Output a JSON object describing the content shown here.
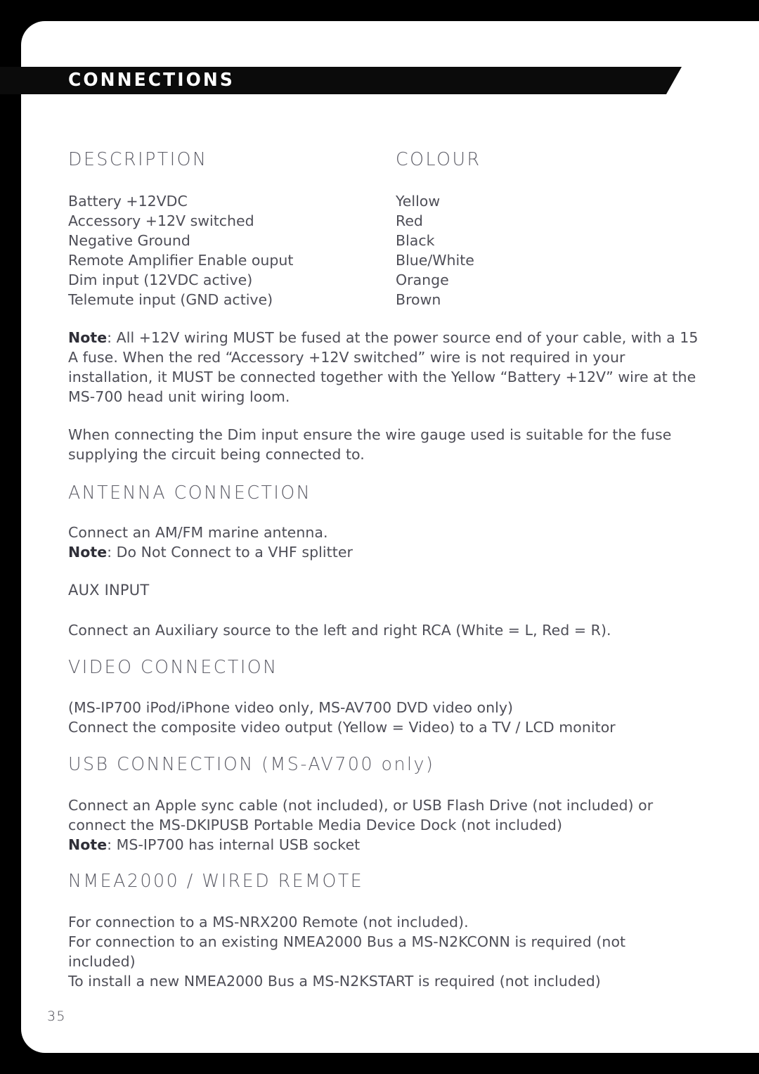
{
  "banner": {
    "title": "CONNECTIONS"
  },
  "table": {
    "headers": {
      "description": "DESCRIPTION",
      "colour": "COLOUR"
    },
    "rows": [
      {
        "description": "Battery +12VDC",
        "colour": "Yellow"
      },
      {
        "description": "Accessory +12V switched",
        "colour": "Red"
      },
      {
        "description": "Negative Ground",
        "colour": "Black"
      },
      {
        "description": "Remote Amplifier Enable ouput",
        "colour": "Blue/White"
      },
      {
        "description": "Dim input (12VDC active)",
        "colour": "Orange"
      },
      {
        "description": "Telemute input (GND active)",
        "colour": "Brown"
      }
    ]
  },
  "notes": {
    "note_label": "Note",
    "power_note": ": All +12V wiring MUST be fused at the power source end of your cable, with a 15 A fuse. When the red “Accessory +12V switched” wire is not required in your installation, it MUST be connected together with the Yellow “Battery +12V” wire at the MS-700 head unit wiring loom.",
    "dim_note": "When connecting the Dim input ensure the wire gauge used is suitable for the fuse supplying the circuit being connected to."
  },
  "sections": {
    "antenna": {
      "heading": "ANTENNA CONNECTION",
      "line1": "Connect an AM/FM marine antenna.",
      "note_label": "Note",
      "note_text": ": Do Not Connect to a VHF splitter"
    },
    "aux": {
      "heading": "AUX INPUT",
      "body": "Connect an Auxiliary source to the left and right RCA (White = L, Red = R)."
    },
    "video": {
      "heading": "VIDEO CONNECTION",
      "line1": "(MS-IP700 iPod/iPhone video only, MS-AV700 DVD video only)",
      "line2": "Connect the composite video output (Yellow = Video) to a TV / LCD monitor"
    },
    "usb": {
      "heading": "USB CONNECTION (MS-AV700 only)",
      "body": "Connect an Apple sync cable (not included), or USB Flash Drive (not included) or connect the MS-DKIPUSB Portable Media Device Dock (not included)",
      "note_label": "Note",
      "note_text": ": MS-IP700 has internal USB socket"
    },
    "nmea": {
      "heading": "NMEA2000  / WIRED REMOTE",
      "line1": "For connection to a MS-NRX200 Remote (not included).",
      "line2": "For connection to an existing NMEA2000 Bus a MS-N2KCONN is required (not included)",
      "line3": "To install a new NMEA2000 Bus a MS-N2KSTART is required (not included)"
    }
  },
  "footer": {
    "page_number": "35"
  },
  "colors": {
    "page_border": "#000000",
    "sheet": "#ffffff",
    "banner": "#0b0b0b",
    "body_text": "#4e4e57",
    "heading_text": "#5c5c66",
    "bold_text": "#2f2f38"
  }
}
